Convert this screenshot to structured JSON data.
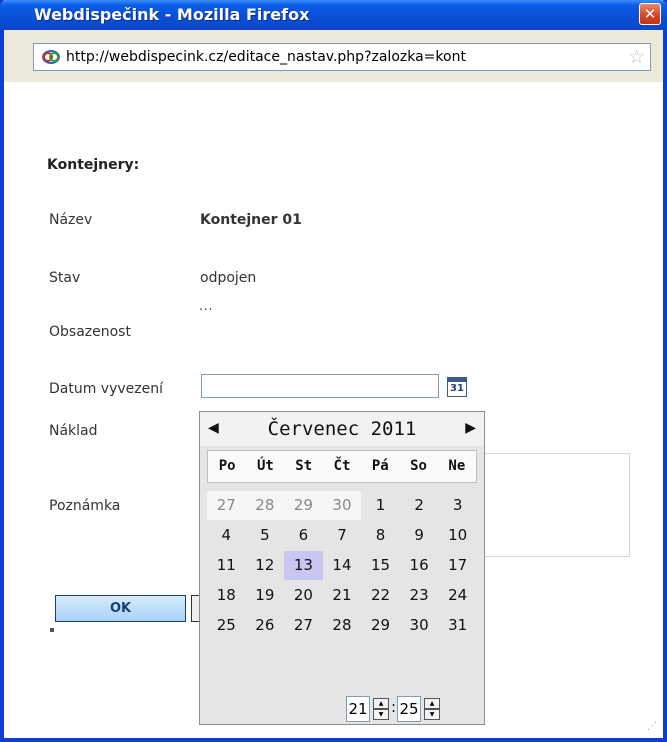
{
  "window": {
    "title": "Webdispečink - Mozilla Firefox",
    "close_label": "✕"
  },
  "addressbar": {
    "url": "http://webdispecink.cz/editace_nastav.php?zalozka=kont"
  },
  "form": {
    "section_title": "Kontejnery:",
    "rows": {
      "nazev_label": "Název",
      "nazev_value": "Kontejner 01",
      "stav_label": "Stav",
      "stav_value": "odpojen",
      "obsazenost_label": "Obsazenost",
      "obsazenost_value": "...",
      "datum_label": "Datum vyvezení",
      "datum_value": "",
      "naklad_label": "Náklad",
      "poznamka_label": "Poznámka"
    },
    "calendar_button_label": "31",
    "ok_label": "OK"
  },
  "calendar": {
    "prev_label": "◀",
    "next_label": "▶",
    "title": "Červenec 2011",
    "weekdays": [
      "Po",
      "Út",
      "St",
      "Čt",
      "Pá",
      "So",
      "Ne"
    ],
    "weeks": [
      [
        {
          "d": "27",
          "o": true
        },
        {
          "d": "28",
          "o": true
        },
        {
          "d": "29",
          "o": true
        },
        {
          "d": "30",
          "o": true
        },
        {
          "d": "1"
        },
        {
          "d": "2"
        },
        {
          "d": "3"
        }
      ],
      [
        {
          "d": "4"
        },
        {
          "d": "5"
        },
        {
          "d": "6"
        },
        {
          "d": "7"
        },
        {
          "d": "8"
        },
        {
          "d": "9"
        },
        {
          "d": "10"
        }
      ],
      [
        {
          "d": "11"
        },
        {
          "d": "12"
        },
        {
          "d": "13",
          "t": true
        },
        {
          "d": "14"
        },
        {
          "d": "15"
        },
        {
          "d": "16"
        },
        {
          "d": "17"
        }
      ],
      [
        {
          "d": "18"
        },
        {
          "d": "19"
        },
        {
          "d": "20"
        },
        {
          "d": "21"
        },
        {
          "d": "22"
        },
        {
          "d": "23"
        },
        {
          "d": "24"
        }
      ],
      [
        {
          "d": "25"
        },
        {
          "d": "26"
        },
        {
          "d": "27"
        },
        {
          "d": "28"
        },
        {
          "d": "29"
        },
        {
          "d": "30"
        },
        {
          "d": "31"
        }
      ]
    ],
    "hour": "21",
    "minute": "25",
    "time_separator": ":"
  },
  "colors": {
    "titlebar": "#0a4fd8",
    "today_highlight": "#c7c7f2",
    "ok_button": "#a9d3f7"
  },
  "icons": {
    "site": "webdispecink-site-icon",
    "bookmark": "star-icon",
    "calendar": "calendar-icon",
    "close": "close-icon"
  }
}
